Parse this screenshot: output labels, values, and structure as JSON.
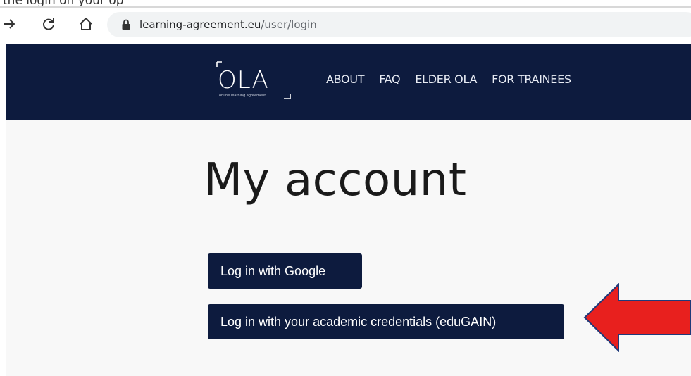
{
  "caption": {
    "text": "the login on your op"
  },
  "browser": {
    "url_host": "learning-agreement.eu",
    "url_path": "/user/login",
    "icons": [
      "forward-arrow-icon",
      "reload-icon",
      "home-icon",
      "lock-icon"
    ]
  },
  "site": {
    "logo_text": "OLA",
    "logo_subtext": "online learning agreement",
    "nav": [
      "ABOUT",
      "FAQ",
      "ELDER OLA",
      "FOR TRAINEES"
    ]
  },
  "main": {
    "title": "My account",
    "google_button": "Log in with Google",
    "edugain_button": "Log in with your academic credentials (eduGAIN)"
  },
  "colors": {
    "header_bg": "#0d1b3e",
    "button_bg": "#0d1b3e",
    "arrow": "#e8201e",
    "page_bg": "#f8f8f8"
  }
}
